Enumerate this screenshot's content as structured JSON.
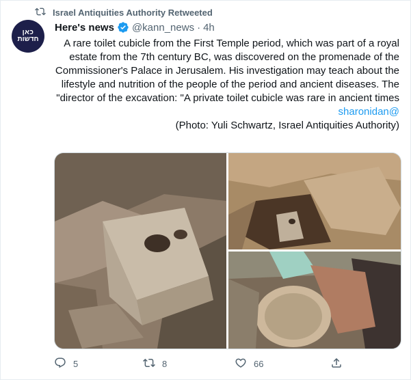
{
  "context": {
    "text": "Israel Antiquities Authority Retweeted",
    "icon": "retweet-icon"
  },
  "avatar": {
    "line1": "כאן",
    "line2": "חדשות",
    "bg": "#1d1f4a"
  },
  "author": {
    "name": "Here's news",
    "handle": "@kann_news",
    "separator": "·",
    "time": "4h",
    "verified_color": "#1d9bf0"
  },
  "tweet": {
    "body": "A rare toilet cubicle from the First Temple period, which was part of a royal estate from the 7th century BC, was discovered on the promenade of the Commissioner's Palace in Jerusalem. His investigation may teach about the lifestyle and nutrition of the people of the period and ancient diseases. The director of the excavation: \"A private toilet cubicle was rare in ancient times\"",
    "mention": "@sharonidan",
    "credit": "(Photo: Yuli Schwartz, Israel Antiquities Authority)"
  },
  "media": [
    {
      "alt": "stone toilet seat with hole"
    },
    {
      "alt": "excavation pit with stone seat"
    },
    {
      "alt": "hand holding soil sample"
    }
  ],
  "actions": {
    "replies": "5",
    "retweets": "8",
    "likes": "66"
  },
  "colors": {
    "accent": "#1d9bf0",
    "muted": "#536471",
    "text": "#0f1419"
  }
}
